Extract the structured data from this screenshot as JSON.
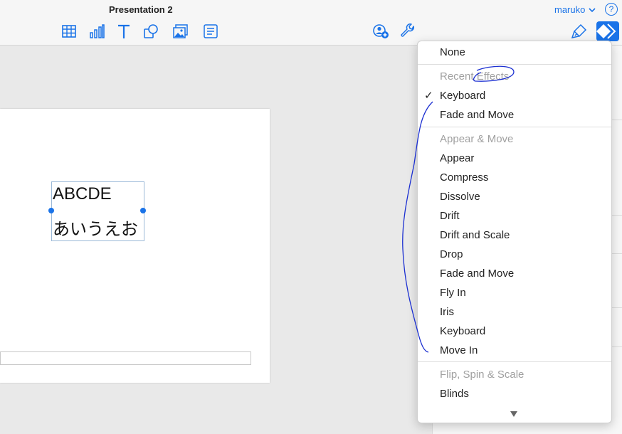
{
  "window": {
    "title": "Presentation 2"
  },
  "user": {
    "name": "maruko",
    "help_label": "?"
  },
  "toolbar": {
    "icons": [
      "table-icon",
      "chart-icon",
      "text-icon",
      "shape-icon",
      "media-icon",
      "comment-icon",
      "collaborate-icon",
      "settings-wrench-icon",
      "format-brush-icon",
      "animate-icon"
    ]
  },
  "slide": {
    "line1": "ABCDE",
    "line2": "あいうえお"
  },
  "animation_menu": {
    "none": "None",
    "recent_header": "Recent Effects",
    "recent": [
      {
        "label": "Keyboard",
        "checked": true
      },
      {
        "label": "Fade and Move",
        "checked": false
      }
    ],
    "appear_move_header": "Appear & Move",
    "appear_move": [
      "Appear",
      "Compress",
      "Dissolve",
      "Drift",
      "Drift and Scale",
      "Drop",
      "Fade and Move",
      "Fly In",
      "Iris",
      "Keyboard",
      "Move In"
    ],
    "flip_header": "Flip, Spin & Scale",
    "flip": [
      "Blinds"
    ],
    "check_mark": "✓"
  },
  "colors": {
    "accent": "#1a73e8",
    "annotation": "#1b2fd1"
  }
}
